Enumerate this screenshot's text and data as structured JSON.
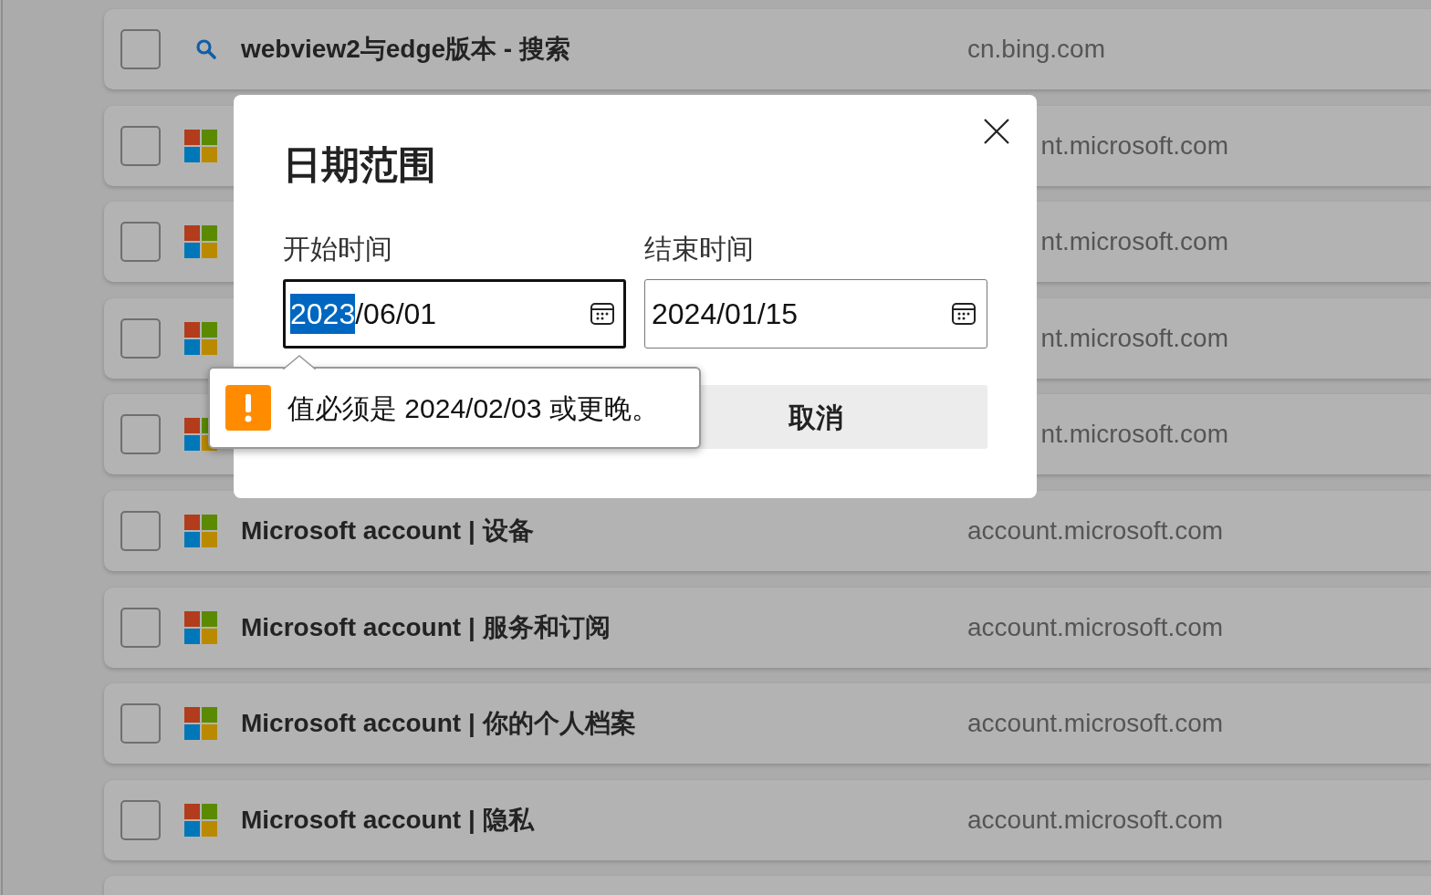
{
  "rows": [
    {
      "checked": false,
      "kind": "search",
      "title": "webview2与edge版本 - 搜索",
      "domain": "cn.bing.com"
    },
    {
      "checked": false,
      "kind": "microsoft",
      "domain": "nt.microsoft.com"
    },
    {
      "checked": false,
      "kind": "microsoft",
      "domain": "nt.microsoft.com"
    },
    {
      "checked": false,
      "kind": "microsoft",
      "domain": "nt.microsoft.com"
    },
    {
      "checked": false,
      "kind": "microsoft",
      "domain": "nt.microsoft.com"
    },
    {
      "checked": false,
      "kind": "microsoft",
      "title": "Microsoft account | 设备",
      "domain": "account.microsoft.com"
    },
    {
      "checked": false,
      "kind": "microsoft",
      "title": "Microsoft account | 服务和订阅",
      "domain": "account.microsoft.com"
    },
    {
      "checked": false,
      "kind": "microsoft",
      "title": "Microsoft account | 你的个人档案",
      "domain": "account.microsoft.com"
    },
    {
      "checked": false,
      "kind": "microsoft",
      "title": "Microsoft account | 隐私",
      "domain": "account.microsoft.com"
    },
    {
      "kind": "empty"
    }
  ],
  "dialog": {
    "title": "日期范围",
    "fields": [
      {
        "label": "开始时间",
        "focused": true,
        "segments": [
          {
            "text": "2023",
            "selected": true
          },
          {
            "text": "/06/01",
            "selected": false
          }
        ]
      },
      {
        "label": "结束时间",
        "focused": false,
        "segments": [
          {
            "text": "2024/01/15",
            "selected": false
          }
        ]
      }
    ],
    "cancel_button": "取消",
    "tooltip": {
      "message": "值必须是 2024/02/03 或更晚。"
    }
  }
}
